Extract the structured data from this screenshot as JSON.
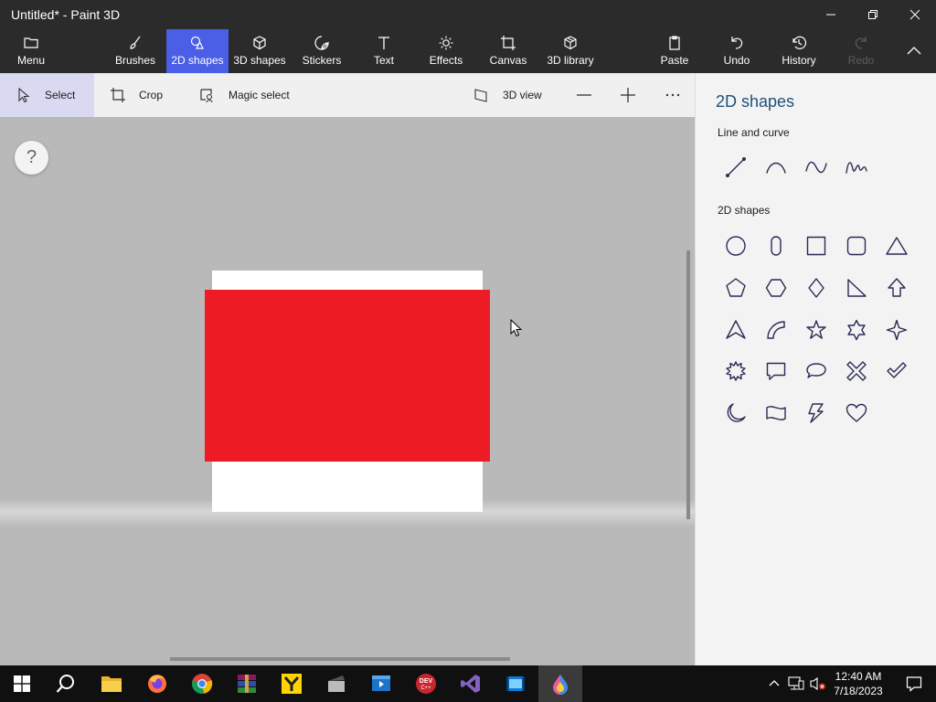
{
  "window": {
    "title": "Untitled* - Paint 3D"
  },
  "ribbon": {
    "menu": "Menu",
    "tabs": [
      {
        "label": "Brushes"
      },
      {
        "label": "2D shapes",
        "active": true
      },
      {
        "label": "3D shapes"
      },
      {
        "label": "Stickers"
      },
      {
        "label": "Text"
      },
      {
        "label": "Effects"
      },
      {
        "label": "Canvas"
      },
      {
        "label": "3D library"
      }
    ],
    "paste": "Paste",
    "undo": "Undo",
    "history": "History",
    "redo": "Redo"
  },
  "toolbar": {
    "select": "Select",
    "crop": "Crop",
    "magic_select": "Magic select",
    "view3d": "3D view"
  },
  "canvas": {
    "help": "?",
    "shape_color": "#ed1c24",
    "page_color": "#ffffff"
  },
  "panel": {
    "title": "2D shapes",
    "line_section": "Line and curve",
    "shapes_section": "2D shapes",
    "line_tools": [
      "line",
      "curve",
      "two-point curve",
      "three-point curve"
    ],
    "shapes": [
      "circle",
      "capsule",
      "square",
      "rounded-square",
      "triangle",
      "pentagon",
      "hexagon",
      "diamond",
      "right-triangle",
      "arrow-up",
      "arrowhead",
      "quarter-circle",
      "five-point-star",
      "six-point-star",
      "four-point-star",
      "burst",
      "speech-bubble",
      "thought-bubble",
      "x-mark",
      "check-mark",
      "crescent",
      "banner",
      "lightning-bolt",
      "heart"
    ]
  },
  "taskbar": {
    "apps": [
      "start",
      "search",
      "file-explorer",
      "firefox",
      "chrome",
      "winrar",
      "yandex",
      "video-app",
      "movie-maker",
      "dev-cpp",
      "visual-studio",
      "media-player",
      "paint-3d"
    ],
    "time": "12:40 AM",
    "date": "7/18/2023"
  },
  "colors": {
    "accent": "#4a5ee6",
    "titlebar": "#2b2b2b",
    "panel_title": "#1f4f7a"
  }
}
